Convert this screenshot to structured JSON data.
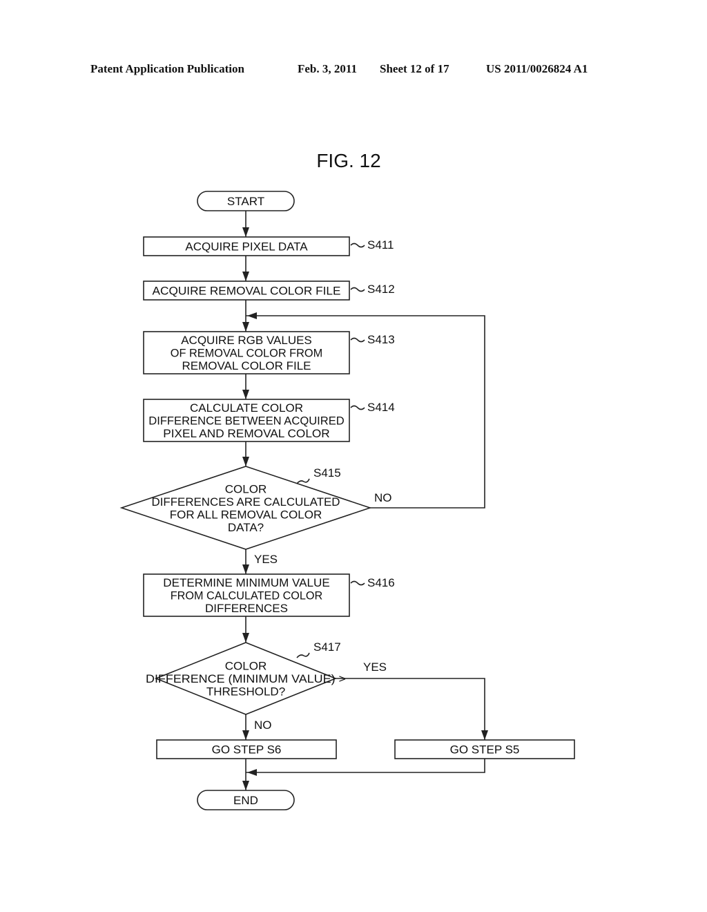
{
  "header": {
    "publication": "Patent Application Publication",
    "date": "Feb. 3, 2011",
    "sheet": "Sheet 12 of 17",
    "number": "US 2011/0026824 A1"
  },
  "figure": {
    "title": "FIG. 12"
  },
  "nodes": {
    "start": {
      "type": "terminal",
      "lines": [
        "START"
      ]
    },
    "s411": {
      "type": "process",
      "step": "S411",
      "lines": [
        "ACQUIRE PIXEL DATA"
      ]
    },
    "s412": {
      "type": "process",
      "step": "S412",
      "lines": [
        "ACQUIRE REMOVAL COLOR FILE"
      ]
    },
    "s413": {
      "type": "process",
      "step": "S413",
      "lines": [
        "ACQUIRE RGB VALUES",
        "OF REMOVAL COLOR FROM",
        "REMOVAL COLOR FILE"
      ]
    },
    "s414": {
      "type": "process",
      "step": "S414",
      "lines": [
        "CALCULATE COLOR",
        "DIFFERENCE BETWEEN ACQUIRED",
        "PIXEL AND REMOVAL COLOR"
      ]
    },
    "s415": {
      "type": "decision",
      "step": "S415",
      "lines": [
        "COLOR",
        "DIFFERENCES ARE CALCULATED",
        "FOR ALL REMOVAL COLOR",
        "DATA?"
      ]
    },
    "s416": {
      "type": "process",
      "step": "S416",
      "lines": [
        "DETERMINE MINIMUM VALUE",
        "FROM CALCULATED COLOR",
        "DIFFERENCES"
      ]
    },
    "s417": {
      "type": "decision",
      "step": "S417",
      "lines": [
        "COLOR",
        "DIFFERENCE (MINIMUM VALUE) >",
        "THRESHOLD?"
      ]
    },
    "go_s6": {
      "type": "process",
      "lines": [
        "GO STEP S6"
      ]
    },
    "go_s5": {
      "type": "process",
      "lines": [
        "GO STEP S5"
      ]
    },
    "end": {
      "type": "terminal",
      "lines": [
        "END"
      ]
    }
  },
  "edges": [
    {
      "from": "start",
      "to": "s411"
    },
    {
      "from": "s411",
      "to": "s412"
    },
    {
      "from": "s412",
      "to": "s413"
    },
    {
      "from": "s413",
      "to": "s414"
    },
    {
      "from": "s414",
      "to": "s415"
    },
    {
      "from": "s415",
      "to": "s413",
      "label": "NO"
    },
    {
      "from": "s415",
      "to": "s416",
      "label": "YES"
    },
    {
      "from": "s416",
      "to": "s417"
    },
    {
      "from": "s417",
      "to": "go_s6",
      "label": "NO"
    },
    {
      "from": "s417",
      "to": "go_s5",
      "label": "YES"
    },
    {
      "from": "go_s6",
      "to": "end"
    },
    {
      "from": "go_s5",
      "to": "end"
    }
  ],
  "labels": {
    "s415_no": "NO",
    "s415_yes": "YES",
    "s417_yes": "YES",
    "s417_no": "NO"
  }
}
